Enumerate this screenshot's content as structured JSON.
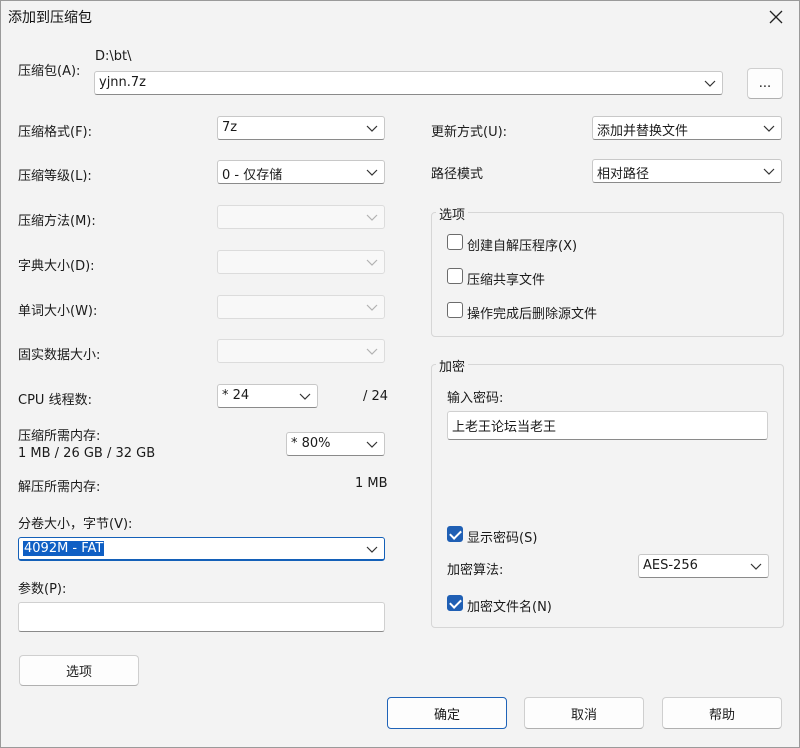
{
  "window": {
    "title": "添加到压缩包"
  },
  "archive": {
    "label": "压缩包(A):",
    "path": "D:\\bt\\",
    "value": "yjnn.7z",
    "browse_label": "..."
  },
  "left": {
    "format": {
      "label": "压缩格式(F):",
      "value": "7z"
    },
    "level": {
      "label": "压缩等级(L):",
      "value": "0 - 仅存储"
    },
    "method": {
      "label": "压缩方法(M):",
      "value": ""
    },
    "dict": {
      "label": "字典大小(D):",
      "value": ""
    },
    "word": {
      "label": "单词大小(W):",
      "value": ""
    },
    "solid": {
      "label": "固实数据大小:",
      "value": ""
    },
    "threads": {
      "label": "CPU 线程数:",
      "value": "* 24",
      "max": "/ 24"
    },
    "memory": {
      "label": "压缩所需内存:",
      "detail": "1 MB / 26 GB / 32 GB",
      "value": "* 80%"
    },
    "decomp": {
      "label": "解压所需内存:",
      "value": "1 MB"
    },
    "volume": {
      "label": "分卷大小，字节(V):",
      "value": "4092M - FAT"
    },
    "params": {
      "label": "参数(P):",
      "value": ""
    },
    "options_button": "选项"
  },
  "right": {
    "update": {
      "label": "更新方式(U):",
      "value": "添加并替换文件"
    },
    "pathmode": {
      "label": "路径模式",
      "value": "相对路径"
    },
    "options_group": {
      "title": "选项",
      "items": [
        {
          "label": "创建自解压程序(X)",
          "checked": false
        },
        {
          "label": "压缩共享文件",
          "checked": false
        },
        {
          "label": "操作完成后删除源文件",
          "checked": false
        }
      ]
    },
    "encryption": {
      "title": "加密",
      "password_label": "输入密码:",
      "password_value": "上老王论坛当老王",
      "show_password": {
        "label": "显示密码(S)",
        "checked": true
      },
      "method_label": "加密算法:",
      "method_value": "AES-256",
      "encrypt_names": {
        "label": "加密文件名(N)",
        "checked": true
      }
    }
  },
  "buttons": {
    "ok": "确定",
    "cancel": "取消",
    "help": "帮助"
  }
}
